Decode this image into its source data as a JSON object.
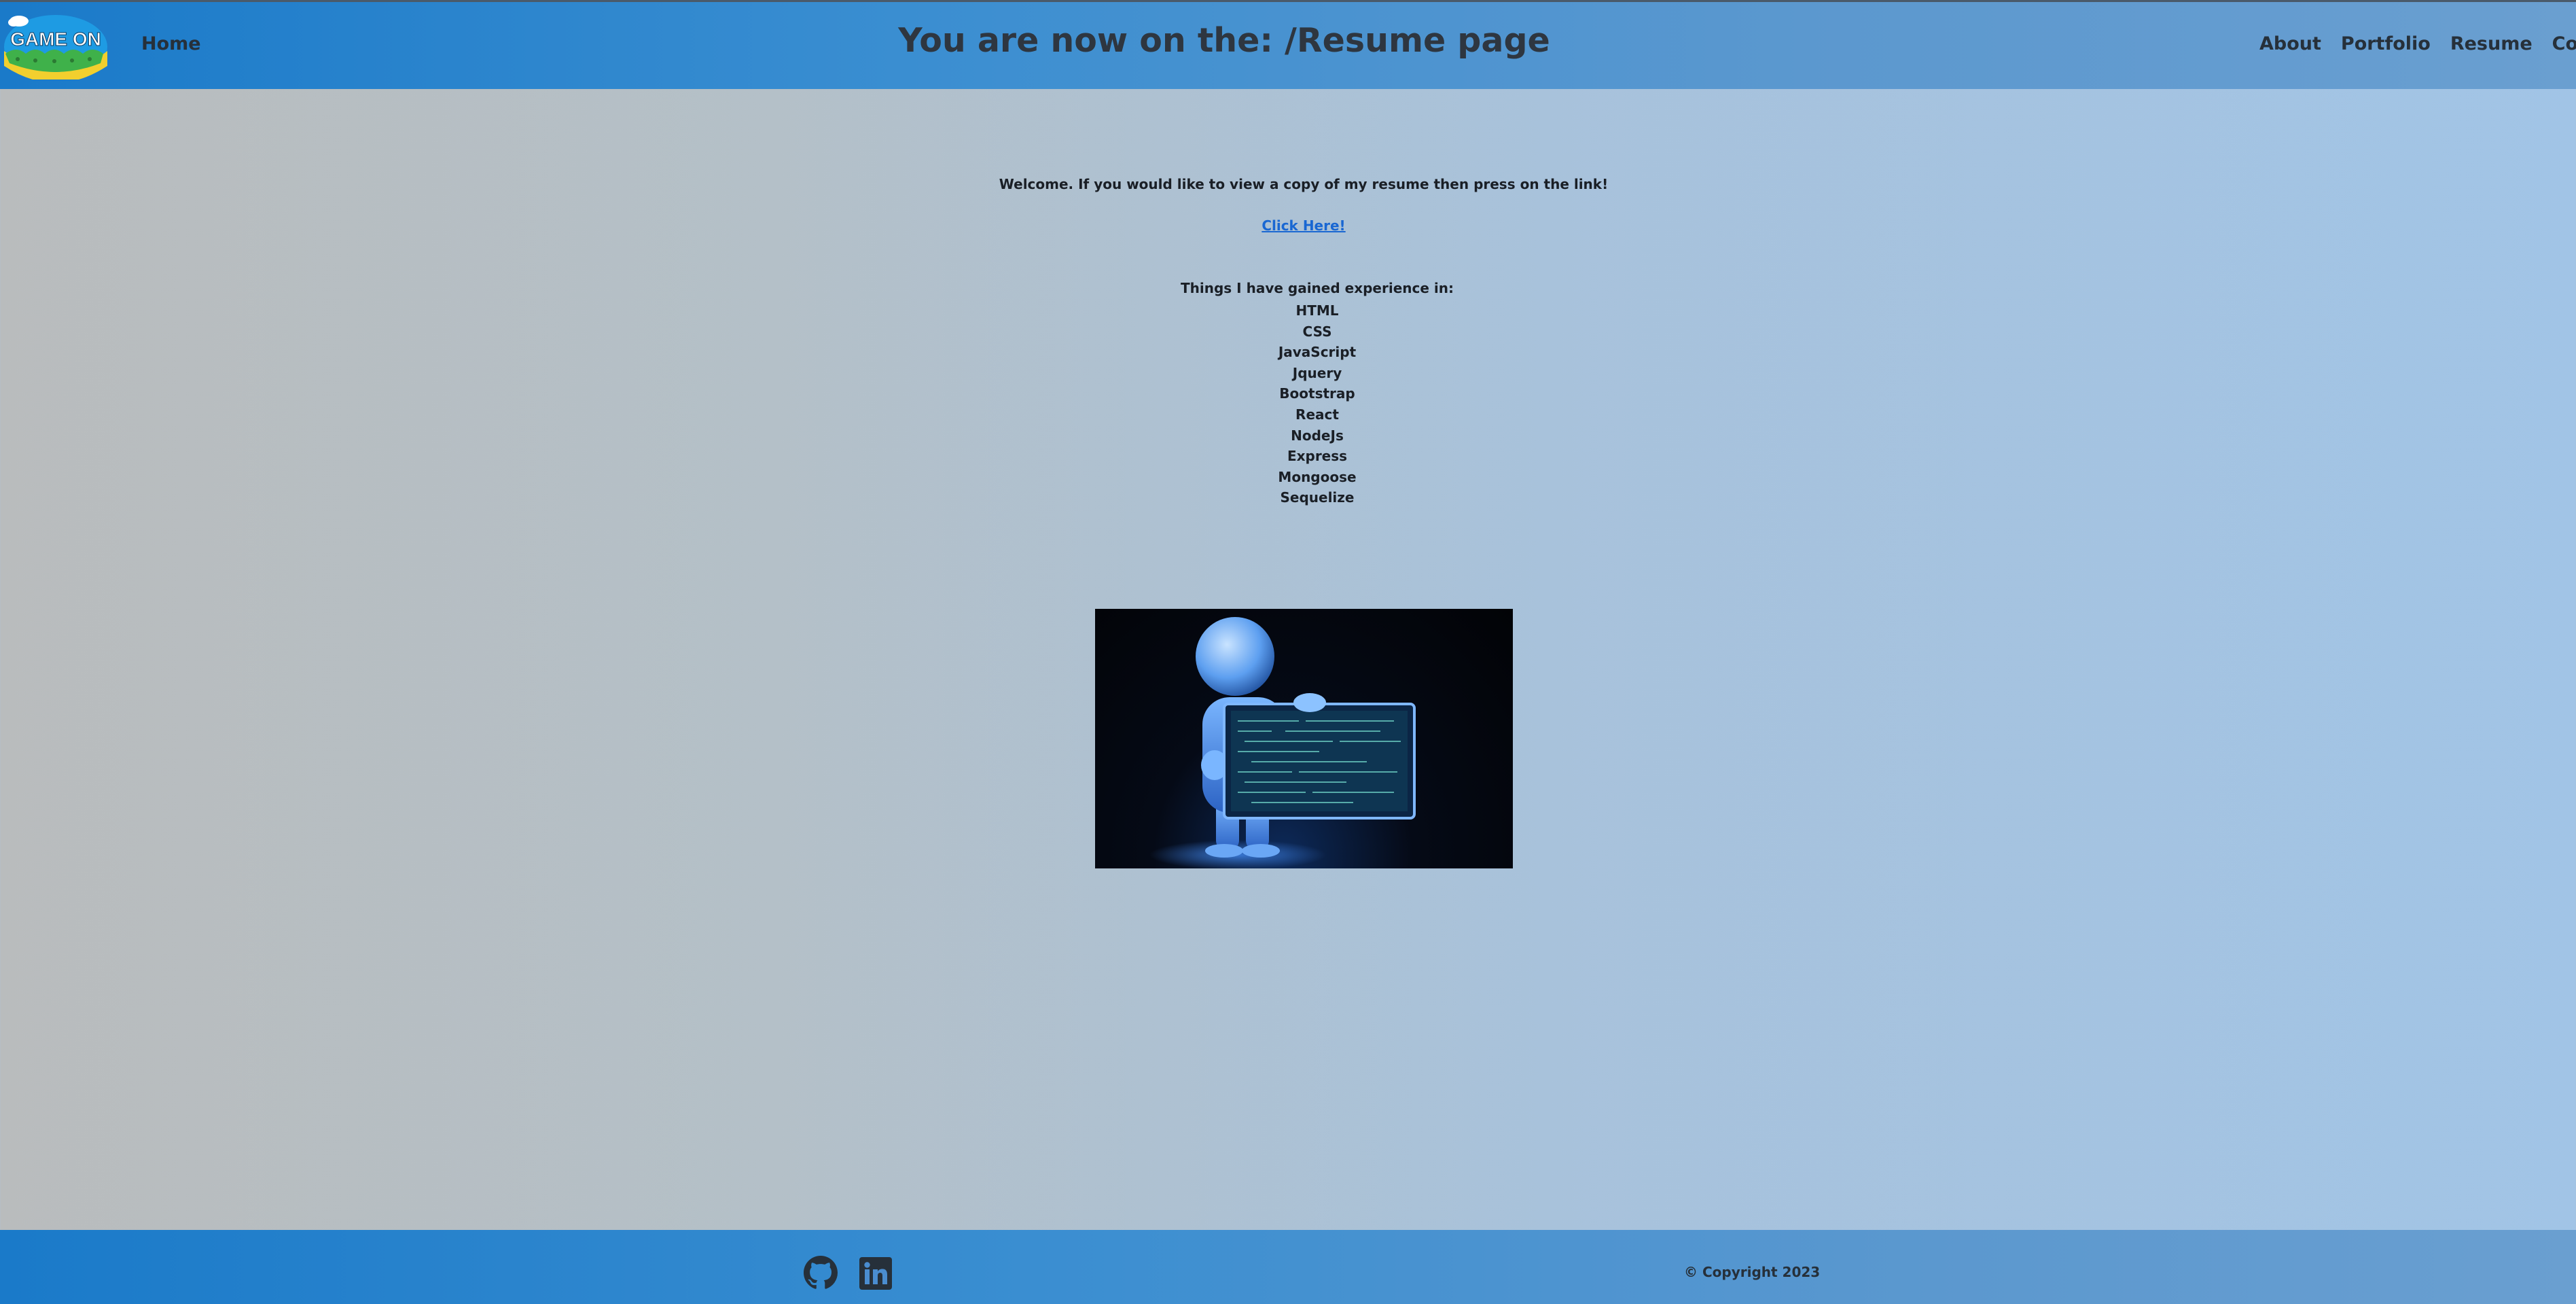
{
  "header": {
    "logo_text": "GAME ON",
    "home_label": "Home",
    "title": "You are now on the: /Resume page",
    "nav": [
      "About",
      "Portfolio",
      "Resume",
      "Contact"
    ]
  },
  "main": {
    "welcome": "Welcome. If you would like to view a copy of my resume then press on the link!",
    "link_label": "Click Here!",
    "experience_heading": "Things I have gained experience in:",
    "skills": [
      "HTML",
      "CSS",
      "JavaScript",
      "Jquery",
      "Bootstrap",
      "React",
      "NodeJs",
      "Express",
      "Mongoose",
      "Sequelize"
    ],
    "image_icon": "glowing-figure-holding-code-screen"
  },
  "footer": {
    "icons": [
      "github-icon",
      "linkedin-icon"
    ],
    "copyright": "© Copyright 2023"
  },
  "colors": {
    "header_gradient_start": "#1a7ac9",
    "header_gradient_end": "#6a9fd0",
    "link": "#1967d2",
    "text": "#1a1f26"
  }
}
